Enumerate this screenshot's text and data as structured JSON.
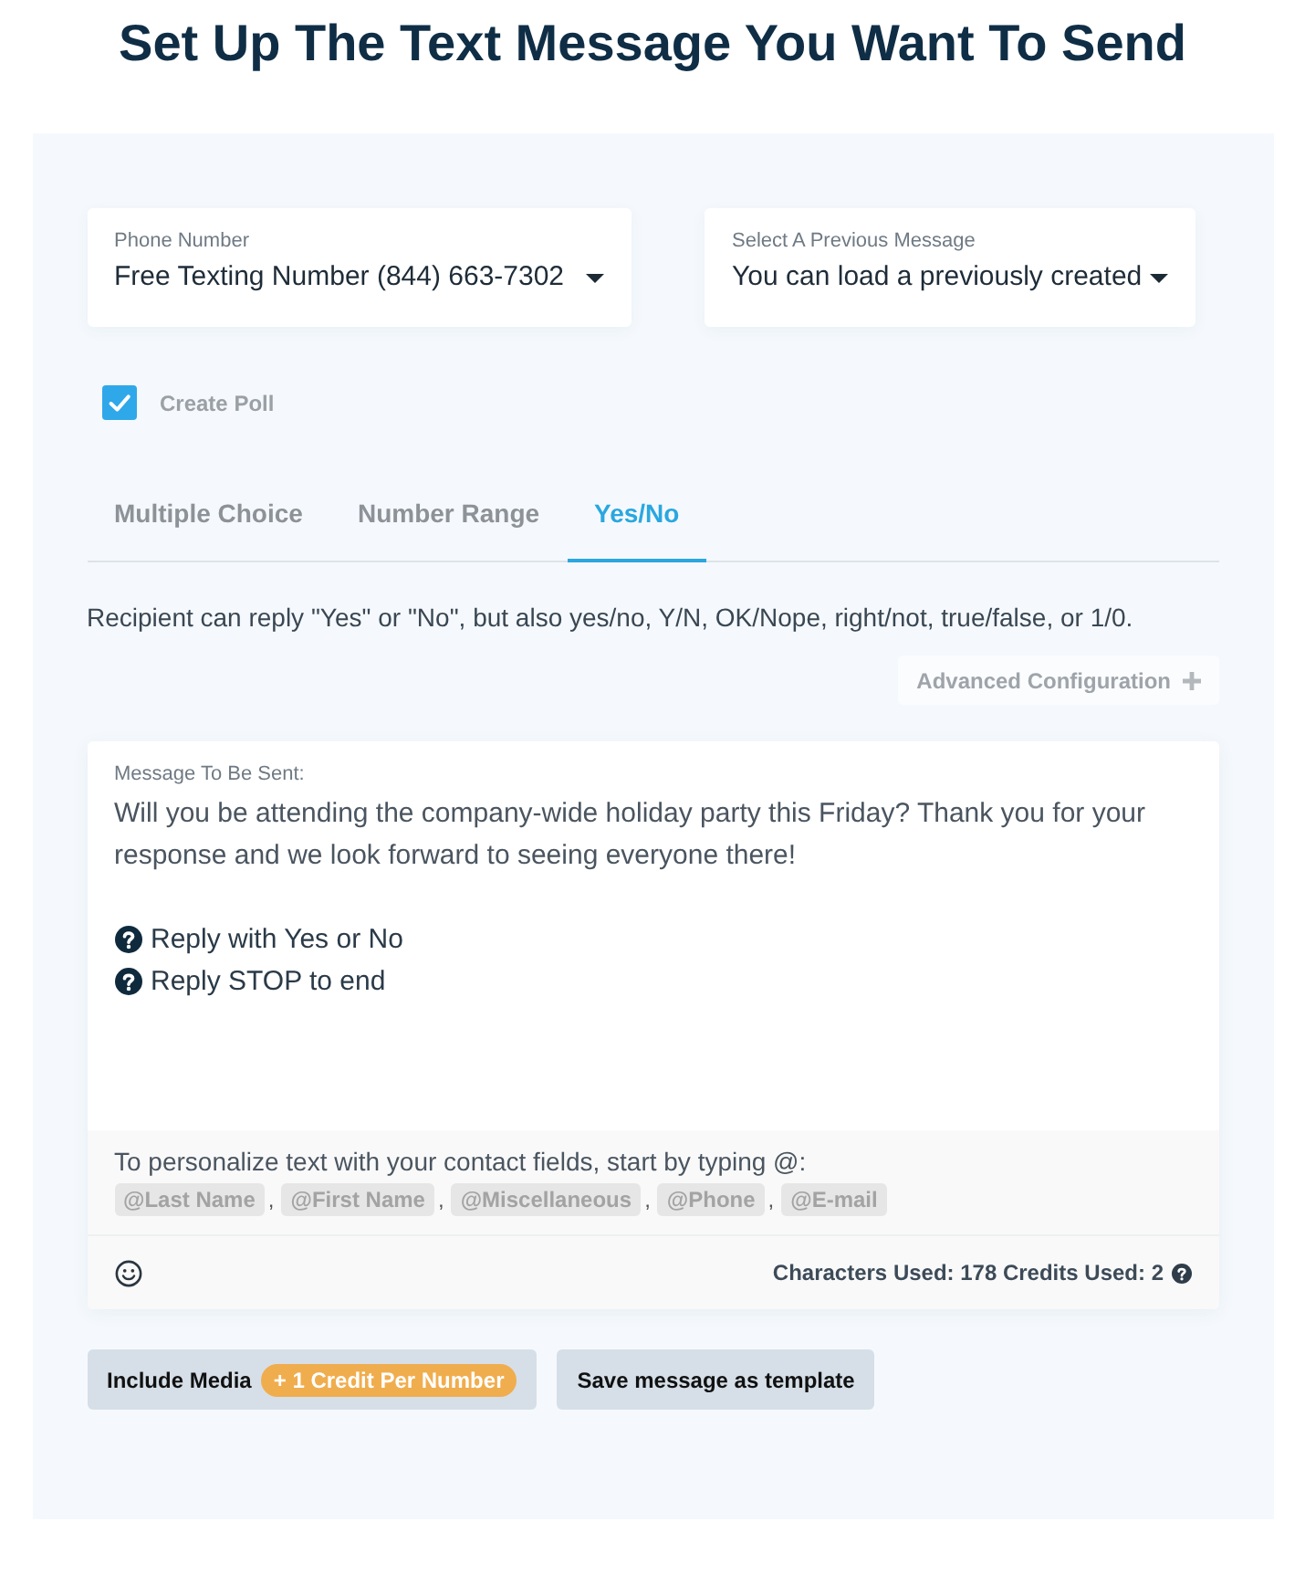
{
  "title": "Set Up The Text Message You Want To Send",
  "selects": [
    {
      "label": "Phone Number",
      "value": "Free Texting Number (844) 663-7302"
    },
    {
      "label": "Select A Previous Message",
      "value": "You can load a previously created"
    }
  ],
  "create_poll": {
    "label": "Create Poll",
    "checked": true
  },
  "poll_tabs": [
    {
      "label": "Multiple Choice",
      "selected": false
    },
    {
      "label": "Number Range",
      "selected": false
    },
    {
      "label": "Yes/No",
      "selected": true
    }
  ],
  "poll_hint": "Recipient can reply \"Yes\" or \"No\", but also yes/no, Y/N, OK/Nope, right/not, true/false, or 1/0.",
  "advanced_button": "Advanced Configuration",
  "message": {
    "label": "Message To Be Sent:",
    "text": "Will you be attending the company-wide holiday party this Friday? Thank you for your response and we look forward to seeing everyone there!",
    "lines": [
      "Reply with Yes or No",
      "Reply STOP to end"
    ]
  },
  "personalize": {
    "hint": "To personalize text with your contact fields, start by typing @:",
    "separator": ",",
    "tags": [
      "@Last Name",
      "@First Name",
      "@Miscellaneous",
      "@Phone",
      "@E-mail"
    ]
  },
  "counter": "Characters Used: 178 Credits Used: 2",
  "buttons": [
    {
      "kind": "media",
      "label": "Include Media",
      "badge": "+ 1 Credit Per Number"
    },
    {
      "kind": "plain",
      "label": "Save message as template"
    }
  ]
}
